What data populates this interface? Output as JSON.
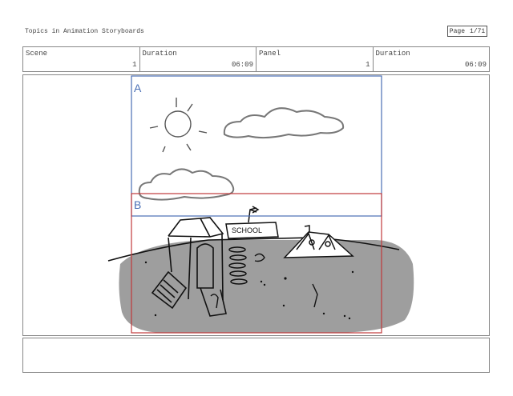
{
  "header": {
    "title": "Topics in Animation Storyboards",
    "page_label": "Page",
    "page_value": "1/71"
  },
  "info": {
    "scene_label": "Scene",
    "scene_value": "1",
    "duration1_label": "Duration",
    "duration1_value": "06:09",
    "panel_label": "Panel",
    "panel_value": "1",
    "duration2_label": "Duration",
    "duration2_value": "06:09"
  },
  "frames": {
    "a_label": "A",
    "a_color": "#4a6fb5",
    "b_label": "B",
    "b_color": "#c0393b"
  },
  "sketch": {
    "school_sign": "SCHOOL",
    "ground_color": "#9e9e9e"
  }
}
